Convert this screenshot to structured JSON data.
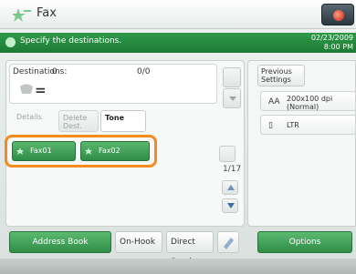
{
  "app": {
    "title": "Fax"
  },
  "message": {
    "text": "Specify the destinations.",
    "date": "02/23/2009",
    "time": "8:00 PM"
  },
  "destinations": {
    "label": "Destinations:",
    "count": "0",
    "page": "0/0"
  },
  "tabs": {
    "details": "Details",
    "delete_dest": "Delete Dest.",
    "tone": "Tone"
  },
  "quick_keys": [
    {
      "label": "Fax01"
    },
    {
      "label": "Fax02"
    }
  ],
  "pager": {
    "count": "1/17"
  },
  "settings": {
    "previous_label": "Previous Settings",
    "resolution": "200x100 dpi (Normal)",
    "resolution_icon": "AA",
    "size": "LTR",
    "size_icon": "page-icon"
  },
  "buttons": {
    "address_book": "Address Book",
    "on_hook": "On-Hook",
    "direct_send": "Direct Send",
    "options": "Options"
  },
  "colors": {
    "accent_green": "#2e8c46",
    "highlight_orange": "#f58a1f"
  }
}
